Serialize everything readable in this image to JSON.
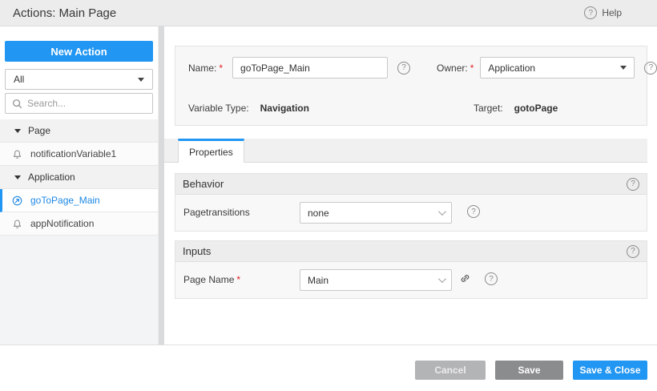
{
  "header": {
    "title": "Actions: Main Page",
    "help_label": "Help"
  },
  "sidebar": {
    "new_action_label": "New Action",
    "filter_value": "All",
    "search_placeholder": "Search...",
    "tree": [
      {
        "kind": "group",
        "label": "Page"
      },
      {
        "kind": "item",
        "label": "notificationVariable1",
        "icon": "notification-icon",
        "selected": false
      },
      {
        "kind": "group",
        "label": "Application"
      },
      {
        "kind": "item",
        "label": "goToPage_Main",
        "icon": "goto-page-icon",
        "selected": true
      },
      {
        "kind": "item",
        "label": "appNotification",
        "icon": "notification-icon",
        "selected": false
      }
    ]
  },
  "form": {
    "name_label": "Name:",
    "name_value": "goToPage_Main",
    "owner_label": "Owner:",
    "owner_value": "Application",
    "variable_type_label": "Variable Type:",
    "variable_type_value": "Navigation",
    "target_label": "Target:",
    "target_value": "gotoPage"
  },
  "tabs": {
    "properties_label": "Properties"
  },
  "sections": {
    "behavior": {
      "title": "Behavior",
      "row": {
        "label": "Pagetransitions",
        "value": "none"
      }
    },
    "inputs": {
      "title": "Inputs",
      "row": {
        "label": "Page Name",
        "value": "Main"
      }
    }
  },
  "footer": {
    "cancel_label": "Cancel",
    "save_label": "Save",
    "save_close_label": "Save & Close"
  },
  "required_marker": "*",
  "icons": {
    "help_glyph": "?"
  },
  "colors": {
    "accent_blue": "#2196f3",
    "selected_text_blue": "#1e88e5",
    "required_red": "#e02020",
    "header_bg": "#ececec",
    "panel_bg": "#f7f7f8"
  }
}
